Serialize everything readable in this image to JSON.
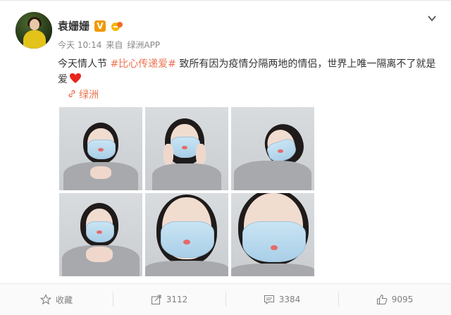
{
  "post": {
    "author": {
      "name": "袁姗姗",
      "verified_badge": "V"
    },
    "time": "今天 10:14",
    "source_prefix": "来自",
    "source": "绿洲APP",
    "text": {
      "prefix": "今天情人节 ",
      "hashtag": "#比心传递爱#",
      "body": " 致所有因为疫情分隔两地的情侣，世界上唯一隔离不了就是爱"
    },
    "link_label": "绿洲",
    "photos": [
      {
        "desc": "mask-heart-hands-1"
      },
      {
        "desc": "mask-hands-on-cheeks"
      },
      {
        "desc": "mask-side-lean"
      },
      {
        "desc": "mask-heart-hands-2"
      },
      {
        "desc": "mask-closeup-1"
      },
      {
        "desc": "mask-closeup-2"
      }
    ]
  },
  "actions": {
    "collect": "收藏",
    "share": "3112",
    "comment": "3384",
    "like": "9095"
  },
  "colors": {
    "accent": "#eb7350",
    "badge_orange": "#f39800",
    "text_gray": "#808080"
  },
  "icons": [
    "star-icon",
    "share-icon",
    "comment-icon",
    "like-icon",
    "link-icon",
    "chevron-down-icon",
    "heart-icon"
  ]
}
